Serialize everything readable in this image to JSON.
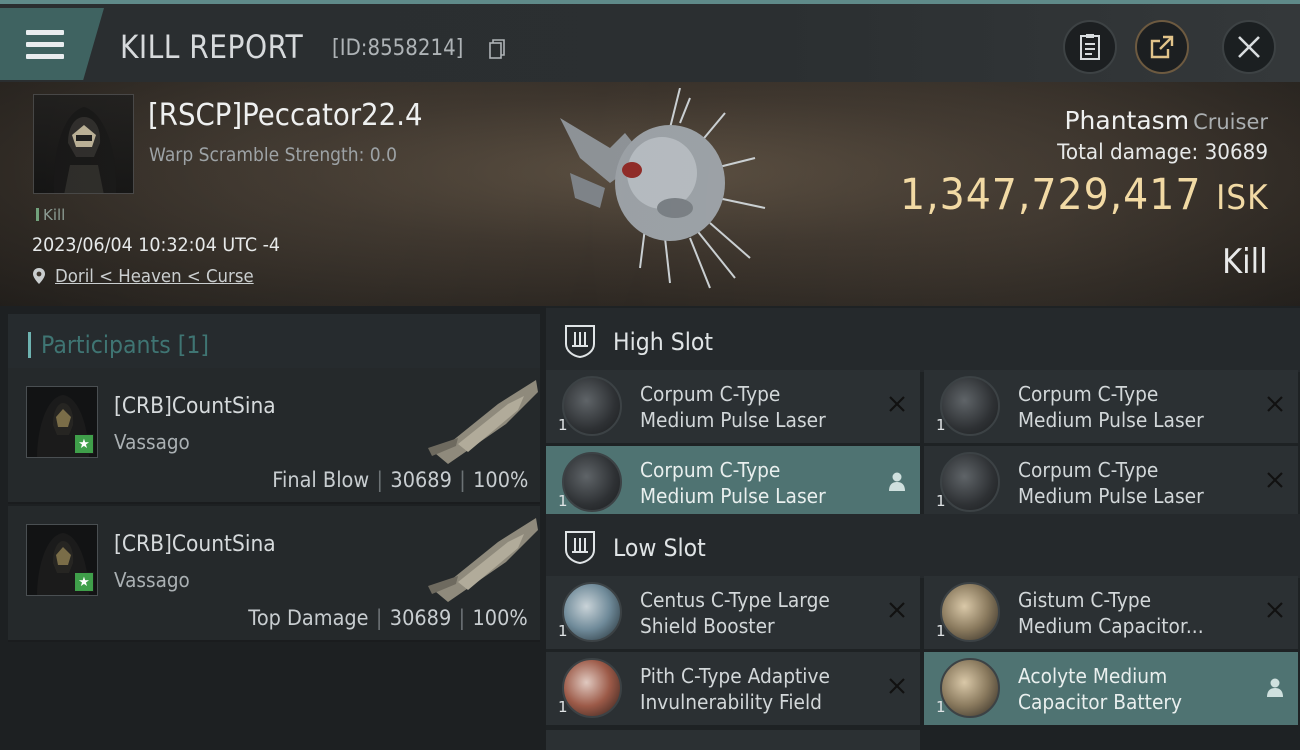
{
  "header": {
    "title": "KILL REPORT",
    "report_id": "[ID:8558214]"
  },
  "victim": {
    "name": "[RSCP]Peccator22.4",
    "warp_scramble": "Warp Scramble Strength: 0.0",
    "tag": "Kill",
    "datetime": "2023/06/04 10:32:04 UTC -4",
    "location": "Doril < Heaven < Curse"
  },
  "ship": {
    "name": "Phantasm",
    "class": "Cruiser",
    "total_damage_label": "Total damage:",
    "total_damage_value": "30689",
    "isk_value": "1,347,729,417",
    "isk_unit": "ISK",
    "result": "Kill"
  },
  "participants": {
    "label": "Participants [1]",
    "rows": [
      {
        "name": "[CRB]CountSina",
        "ship": "Vassago",
        "role": "Final Blow",
        "damage": "30689",
        "percent": "100%"
      },
      {
        "name": "[CRB]CountSina",
        "ship": "Vassago",
        "role": "Top Damage",
        "damage": "30689",
        "percent": "100%"
      }
    ]
  },
  "high_slot": {
    "title": "High Slot",
    "modules": [
      {
        "line1": "Corpum C-Type",
        "line2": "Medium Pulse Laser",
        "qty": "1",
        "state": "destroyed"
      },
      {
        "line1": "Corpum C-Type",
        "line2": "Medium Pulse Laser",
        "qty": "1",
        "state": "destroyed"
      },
      {
        "line1": "Corpum C-Type",
        "line2": "Medium Pulse Laser",
        "qty": "1",
        "state": "dropped"
      },
      {
        "line1": "Corpum C-Type",
        "line2": "Medium Pulse Laser",
        "qty": "1",
        "state": "destroyed"
      }
    ]
  },
  "low_slot": {
    "title": "Low Slot",
    "modules": [
      {
        "line1": "Centus C-Type Large",
        "line2": "Shield Booster",
        "qty": "1",
        "state": "destroyed"
      },
      {
        "line1": "Gistum C-Type",
        "line2": "Medium Capacitor...",
        "qty": "1",
        "state": "destroyed"
      },
      {
        "line1": "Pith C-Type Adaptive",
        "line2": "Invulnerability Field",
        "qty": "1",
        "state": "destroyed"
      },
      {
        "line1": "Acolyte Medium",
        "line2": "Capacitor Battery",
        "qty": "1",
        "state": "dropped"
      }
    ]
  },
  "colors": {
    "accent_teal": "#4f7372",
    "isk_gold": "#f1d9a3",
    "star_green": "#3f9f4a"
  },
  "icons": [
    "menu-icon",
    "copy-icon",
    "clipboard-icon",
    "share-icon",
    "close-icon",
    "location-pin-icon",
    "high-slot-icon",
    "low-slot-icon",
    "destroyed-x-icon",
    "dropped-person-icon"
  ]
}
